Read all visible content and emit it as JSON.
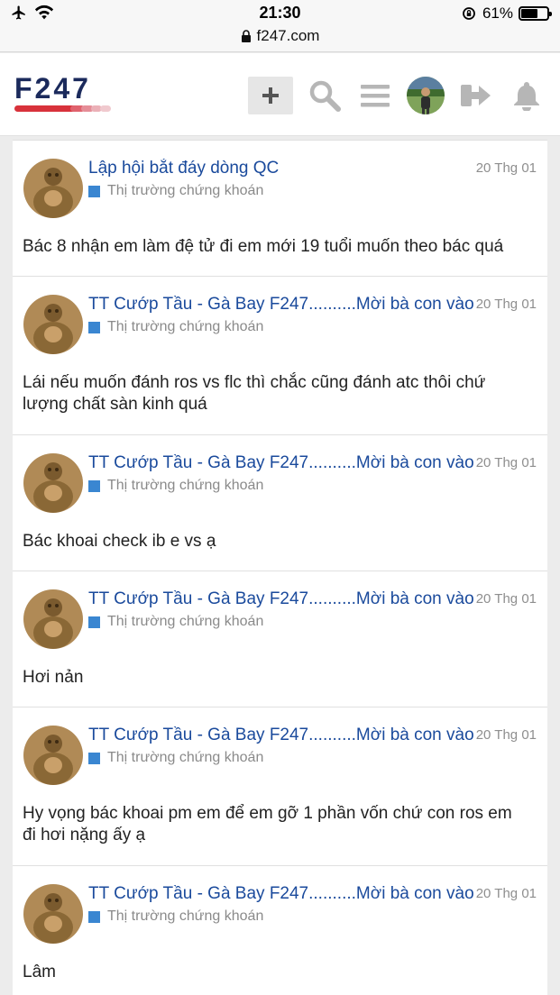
{
  "status_bar": {
    "time": "21:30",
    "battery": "61%",
    "url": "f247.com"
  },
  "header": {
    "logo_text": "F247",
    "icons": [
      "plus-icon",
      "search-icon",
      "menu-icon",
      "avatar",
      "logout-icon",
      "bell-icon"
    ]
  },
  "posts": [
    {
      "title": "Lập hội bắt đáy dòng QC",
      "date": "20 Thg 01",
      "category": "Thị trường chứng khoán",
      "body": [
        "Bác 8 nhận em làm đệ tử đi em mới 19 tuổi muốn theo bác quá"
      ]
    },
    {
      "title": "TT Cướp Tầu - Gà Bay F247..........Mời bà con vào",
      "date": "20 Thg 01",
      "category": "Thị trường chứng khoán",
      "body": [
        "Lái nếu muốn đánh ros vs flc thì chắc cũng đánh atc thôi chứ",
        "lượng chất sàn kinh quá"
      ]
    },
    {
      "title": "TT Cướp Tầu - Gà Bay F247..........Mời bà con vào",
      "date": "20 Thg 01",
      "category": "Thị trường chứng khoán",
      "body": [
        "Bác khoai check ib e vs ạ"
      ]
    },
    {
      "title": "TT Cướp Tầu - Gà Bay F247..........Mời bà con vào",
      "date": "20 Thg 01",
      "category": "Thị trường chứng khoán",
      "body": [
        "Hơi nản"
      ]
    },
    {
      "title": "TT Cướp Tầu - Gà Bay F247..........Mời bà con vào",
      "date": "20 Thg 01",
      "category": "Thị trường chứng khoán",
      "body": [
        "Hy vọng bác khoai pm em để em gỡ 1 phần vốn chứ con ros em",
        "đi hơi nặng ấy ạ"
      ]
    },
    {
      "title": "TT Cướp Tầu - Gà Bay F247..........Mời bà con vào",
      "date": "20 Thg 01",
      "category": "Thị trường chứng khoán",
      "body": [
        "Lâm"
      ]
    }
  ]
}
